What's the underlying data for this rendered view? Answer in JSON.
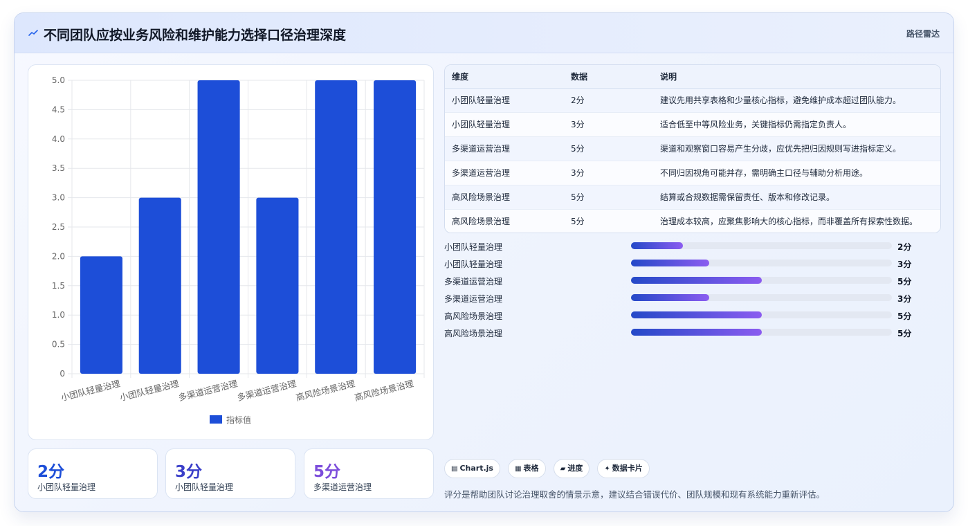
{
  "header": {
    "title": "不同团队应按业务风险和维护能力选择口径治理深度",
    "right_label": "路径雷达",
    "icon": "spark-line-icon"
  },
  "chart_data": {
    "type": "bar",
    "categories": [
      "小团队轻量治理",
      "小团队轻量治理",
      "多渠道运营治理",
      "多渠道运营治理",
      "高风险场景治理",
      "高风险场景治理"
    ],
    "series": [
      {
        "name": "指标值",
        "values": [
          2,
          3,
          5,
          3,
          5,
          5
        ]
      }
    ],
    "ylim": [
      0,
      5
    ],
    "yticks": [
      "0",
      "0.5",
      "1.0",
      "1.5",
      "2.0",
      "2.5",
      "3.0",
      "3.5",
      "4.0",
      "4.5",
      "5.0"
    ],
    "grid": true,
    "legend": "bottom",
    "bar_color": "#1d4ed8"
  },
  "kpis": [
    {
      "value": "2分",
      "label": "小团队轻量治理",
      "color": "#1d4ed8"
    },
    {
      "value": "3分",
      "label": "小团队轻量治理",
      "color": "#3b3fc9"
    },
    {
      "value": "5分",
      "label": "多渠道运营治理",
      "color": "#7c4ddb"
    }
  ],
  "table": {
    "headers": [
      "维度",
      "数据",
      "说明"
    ],
    "rows": [
      [
        "小团队轻量治理",
        "2分",
        "建议先用共享表格和少量核心指标，避免维护成本超过团队能力。"
      ],
      [
        "小团队轻量治理",
        "3分",
        "适合低至中等风险业务，关键指标仍需指定负责人。"
      ],
      [
        "多渠道运营治理",
        "5分",
        "渠道和观察窗口容易产生分歧，应优先把归因规则写进指标定义。"
      ],
      [
        "多渠道运营治理",
        "3分",
        "不同归因视角可能并存，需明确主口径与辅助分析用途。"
      ],
      [
        "高风险场景治理",
        "5分",
        "结算或合规数据需保留责任、版本和修改记录。"
      ],
      [
        "高风险场景治理",
        "5分",
        "治理成本较高，应聚焦影响大的核心指标，而非覆盖所有探索性数据。"
      ]
    ]
  },
  "progress": {
    "max": 10,
    "items": [
      {
        "label": "小团队轻量治理",
        "value": 2,
        "text": "2分"
      },
      {
        "label": "小团队轻量治理",
        "value": 3,
        "text": "3分"
      },
      {
        "label": "多渠道运营治理",
        "value": 5,
        "text": "5分"
      },
      {
        "label": "多渠道运营治理",
        "value": 3,
        "text": "3分"
      },
      {
        "label": "高风险场景治理",
        "value": 5,
        "text": "5分"
      },
      {
        "label": "高风险场景治理",
        "value": 5,
        "text": "5分"
      }
    ]
  },
  "chips": [
    {
      "icon": "chart-icon",
      "label": "Chart.js"
    },
    {
      "icon": "table-icon",
      "label": "表格"
    },
    {
      "icon": "progress-icon",
      "label": "进度"
    },
    {
      "icon": "card-icon",
      "label": "数据卡片"
    }
  ],
  "footer_note": "评分是帮助团队讨论治理取舍的情景示意，建议结合错误代价、团队规模和现有系统能力重新评估。"
}
